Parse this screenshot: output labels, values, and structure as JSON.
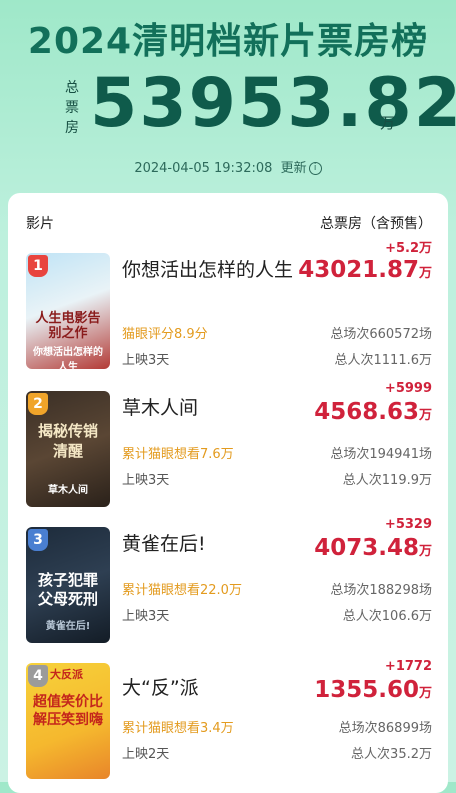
{
  "header": {
    "title": "2024清明档新片票房榜",
    "total_label": "总票房",
    "total_value": "53953.82",
    "total_unit": "万",
    "updated_time": "2024-04-05  19:32:08",
    "updated_label": "更新"
  },
  "table": {
    "col_movie": "影片",
    "col_box": "总票房（含预售）"
  },
  "movies": [
    {
      "rank": "1",
      "name": "你想活出怎样的人生",
      "sub1": "猫眼评分8.9分",
      "sub2": "上映3天",
      "delta": "+5.2万",
      "box": "43021.87",
      "unit": "万",
      "sessions": "总场次660572场",
      "viewers": "总人次1111.6万",
      "poster_text": "人生电影告别之作",
      "poster_title": "你想活出怎样的人生",
      "rank_color": "#e8443e"
    },
    {
      "rank": "2",
      "name": "草木人间",
      "sub1": "累计猫眼想看7.6万",
      "sub2": "上映3天",
      "delta": "+5999",
      "box": "4568.63",
      "unit": "万",
      "sessions": "总场次194941场",
      "viewers": "总人次119.9万",
      "poster_text": "揭秘传销 清醒",
      "poster_title": "草木人间",
      "rank_color": "#f0a42a"
    },
    {
      "rank": "3",
      "name": "黄雀在后!",
      "sub1": "累计猫眼想看22.0万",
      "sub2": "上映3天",
      "delta": "+5329",
      "box": "4073.48",
      "unit": "万",
      "sessions": "总场次188298场",
      "viewers": "总人次106.6万",
      "poster_text": "孩子犯罪 父母死刑",
      "poster_title": "黄雀在后!",
      "rank_color": "#4a7fd1"
    },
    {
      "rank": "4",
      "name": "大“反”派",
      "sub1": "累计猫眼想看3.4万",
      "sub2": "上映2天",
      "delta": "+1772",
      "box": "1355.60",
      "unit": "万",
      "sessions": "总场次86899场",
      "viewers": "总人次35.2万",
      "poster_text": "超值笑价比 解压笑到嗨",
      "poster_title": "大反派",
      "rank_color": "#9b9b9b"
    }
  ]
}
